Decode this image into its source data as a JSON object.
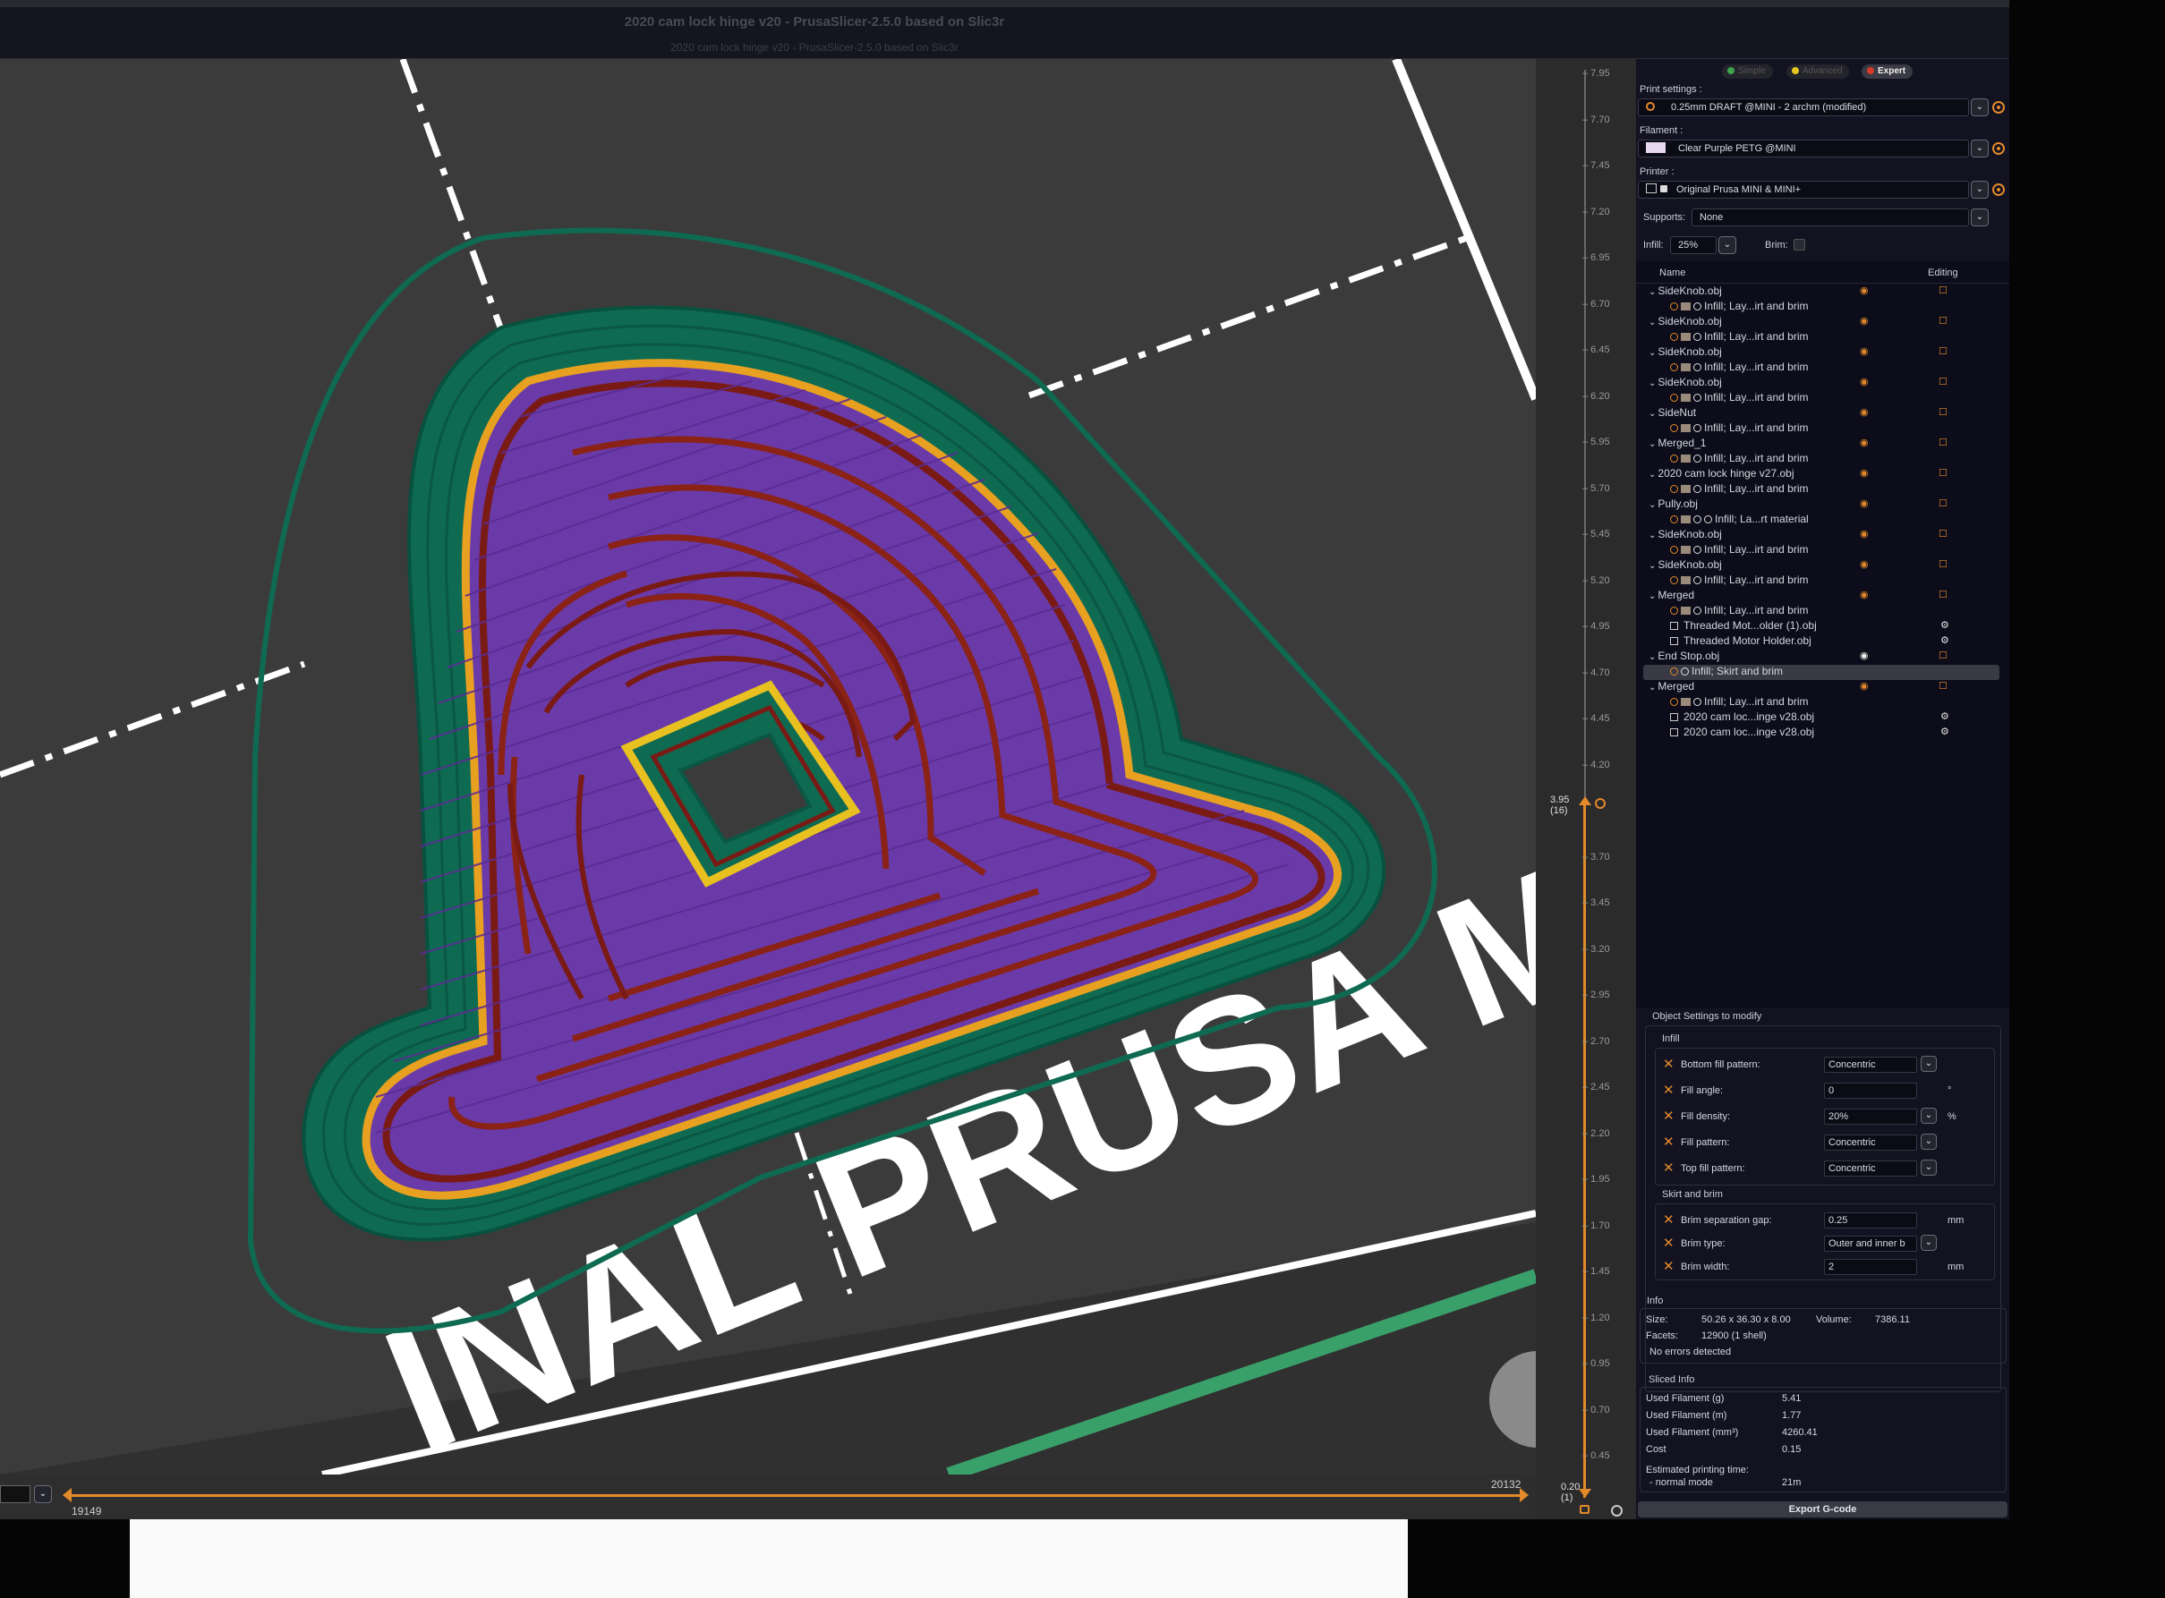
{
  "window": {
    "title": "2020 cam lock hinge v20 - PrusaSlicer-2.5.0 based on Slic3r",
    "subtitle": "2020 cam lock hinge v20 - PrusaSlicer-2.5.0 based on Slic3r"
  },
  "bed": {
    "label": "INAL PRUSA M"
  },
  "colors": {
    "perimeter": "#7a1a14",
    "infill": "#6a3aa8",
    "external_perimeter": "#e0a020",
    "skirt_brim": "#0f6a52",
    "accent": "#e38a2a",
    "viewport_bg": "#3b3b3b"
  },
  "horizontal_slider": {
    "left_value": "19149",
    "right_value": "20132"
  },
  "vertical_slider": {
    "ticks": [
      "7.95",
      "7.70",
      "7.45",
      "7.20",
      "6.95",
      "6.70",
      "6.45",
      "6.20",
      "5.95",
      "5.70",
      "5.45",
      "5.20",
      "4.95",
      "4.70",
      "4.45",
      "4.20",
      "3.95",
      "3.70",
      "3.45",
      "3.20",
      "2.95",
      "2.70",
      "2.45",
      "2.20",
      "1.95",
      "1.70",
      "1.45",
      "1.20",
      "0.95",
      "0.70",
      "0.45"
    ],
    "upper_handle_value": "3.95",
    "upper_handle_layer": "(16)",
    "lower_handle_value": "0.20",
    "lower_handle_layer": "(1)"
  },
  "modes": [
    {
      "label": "Simple",
      "color": "#3fa34d"
    },
    {
      "label": "Advanced",
      "color": "#e6c820"
    },
    {
      "label": "Expert",
      "color": "#d83a2a"
    }
  ],
  "print_settings": {
    "label": "Print settings :",
    "value": "0.25mm DRAFT @MINI - 2 archm (modified)"
  },
  "filament": {
    "label": "Filament :",
    "value": "Clear Purple PETG @MINI",
    "swatch": "#e8d8f0"
  },
  "printer": {
    "label": "Printer :",
    "value": "Original Prusa MINI & MINI+"
  },
  "supports": {
    "label": "Supports:",
    "value": "None"
  },
  "infill": {
    "label": "Infill:",
    "value": "25%"
  },
  "brim": {
    "label": "Brim:"
  },
  "object_list": {
    "col_name": "Name",
    "col_editing": "Editing",
    "rows": [
      {
        "name": "SideKnob.obj",
        "level": 0,
        "eye": true,
        "edit": true
      },
      {
        "name": "Infill; Lay...irt and brim",
        "level": 1,
        "chips": "settings"
      },
      {
        "name": "SideKnob.obj",
        "level": 0,
        "eye": true,
        "edit": true
      },
      {
        "name": "Infill; Lay...irt and brim",
        "level": 1,
        "chips": "settings"
      },
      {
        "name": "SideKnob.obj",
        "level": 0,
        "eye": true,
        "edit": true
      },
      {
        "name": "Infill; Lay...irt and brim",
        "level": 1,
        "chips": "settings"
      },
      {
        "name": "SideKnob.obj",
        "level": 0,
        "eye": true,
        "edit": true
      },
      {
        "name": "Infill; Lay...irt and brim",
        "level": 1,
        "chips": "settings"
      },
      {
        "name": "SideNut",
        "level": 0,
        "eye": true,
        "edit": true
      },
      {
        "name": "Infill; Lay...irt and brim",
        "level": 1,
        "chips": "settings"
      },
      {
        "name": "Merged_1",
        "level": 0,
        "eye": true,
        "edit": true
      },
      {
        "name": "Infill; Lay...irt and brim",
        "level": 1,
        "chips": "settings"
      },
      {
        "name": "2020 cam lock hinge v27.obj",
        "level": 0,
        "eye": true,
        "edit": true
      },
      {
        "name": "Infill; Lay...irt and brim",
        "level": 1,
        "chips": "settings"
      },
      {
        "name": "Pully.obj",
        "level": 0,
        "eye": true,
        "edit": true
      },
      {
        "name": "Infill; La...rt material",
        "level": 1,
        "chips": "settings2"
      },
      {
        "name": "SideKnob.obj",
        "level": 0,
        "eye": true,
        "edit": true
      },
      {
        "name": "Infill; Lay...irt and brim",
        "level": 1,
        "chips": "settings"
      },
      {
        "name": "SideKnob.obj",
        "level": 0,
        "eye": true,
        "edit": true
      },
      {
        "name": "Infill; Lay...irt and brim",
        "level": 1,
        "chips": "settings"
      },
      {
        "name": "Merged",
        "level": 0,
        "eye": true,
        "edit": true
      },
      {
        "name": "Infill; Lay...irt and brim",
        "level": 1,
        "chips": "settings"
      },
      {
        "name": "Threaded Mot...older (1).obj",
        "level": 1,
        "chips": "part",
        "gear": true
      },
      {
        "name": "Threaded Motor Holder.obj",
        "level": 1,
        "chips": "part",
        "gear": true
      },
      {
        "name": "End Stop.obj",
        "level": 0,
        "eye": true,
        "edit": true,
        "eye_white": true
      },
      {
        "name": "Infill; Skirt and brim",
        "level": 1,
        "chips": "settings3",
        "selected": true
      },
      {
        "name": "Merged",
        "level": 0,
        "eye": true,
        "edit": true
      },
      {
        "name": "Infill; Lay...irt and brim",
        "level": 1,
        "chips": "settings"
      },
      {
        "name": "2020 cam loc...inge v28.obj",
        "level": 1,
        "chips": "part",
        "gear": true
      },
      {
        "name": "2020 cam loc...inge v28.obj",
        "level": 1,
        "chips": "part",
        "gear": true
      }
    ]
  },
  "object_settings": {
    "title": "Object Settings to modify",
    "infill_group": "Infill",
    "infill_rows": [
      {
        "label": "Bottom fill pattern:",
        "value": "Concentric",
        "dropdown": true,
        "unit": ""
      },
      {
        "label": "Fill angle:",
        "value": "0",
        "dropdown": false,
        "unit": "°"
      },
      {
        "label": "Fill density:",
        "value": "20%",
        "dropdown": true,
        "unit": "%"
      },
      {
        "label": "Fill pattern:",
        "value": "Concentric",
        "dropdown": true,
        "unit": ""
      },
      {
        "label": "Top fill pattern:",
        "value": "Concentric",
        "dropdown": true,
        "unit": ""
      }
    ],
    "skirt_group": "Skirt and brim",
    "skirt_rows": [
      {
        "label": "Brim separation gap:",
        "value": "0.25",
        "dropdown": false,
        "unit": "mm"
      },
      {
        "label": "Brim type:",
        "value": "Outer and inner b",
        "dropdown": true,
        "unit": ""
      },
      {
        "label": "Brim width:",
        "value": "2",
        "dropdown": false,
        "unit": "mm"
      }
    ]
  },
  "info": {
    "title": "Info",
    "size_label": "Size:",
    "size_value": "50.26 x 36.30 x 8.00",
    "volume_label": "Volume:",
    "volume_value": "7386.11",
    "facets_label": "Facets:",
    "facets_value": "12900 (1 shell)",
    "errors": "No errors detected"
  },
  "sliced_info": {
    "title": "Sliced Info",
    "rows": [
      {
        "label": "Used Filament (g)",
        "value": "5.41"
      },
      {
        "label": "Used Filament (m)",
        "value": "1.77"
      },
      {
        "label": "Used Filament (mm³)",
        "value": "4260.41"
      },
      {
        "label": "Cost",
        "value": "0.15"
      }
    ],
    "time_label": "Estimated printing time:",
    "mode_label": "- normal mode",
    "time_value": "21m"
  },
  "export_button": "Export G-code"
}
